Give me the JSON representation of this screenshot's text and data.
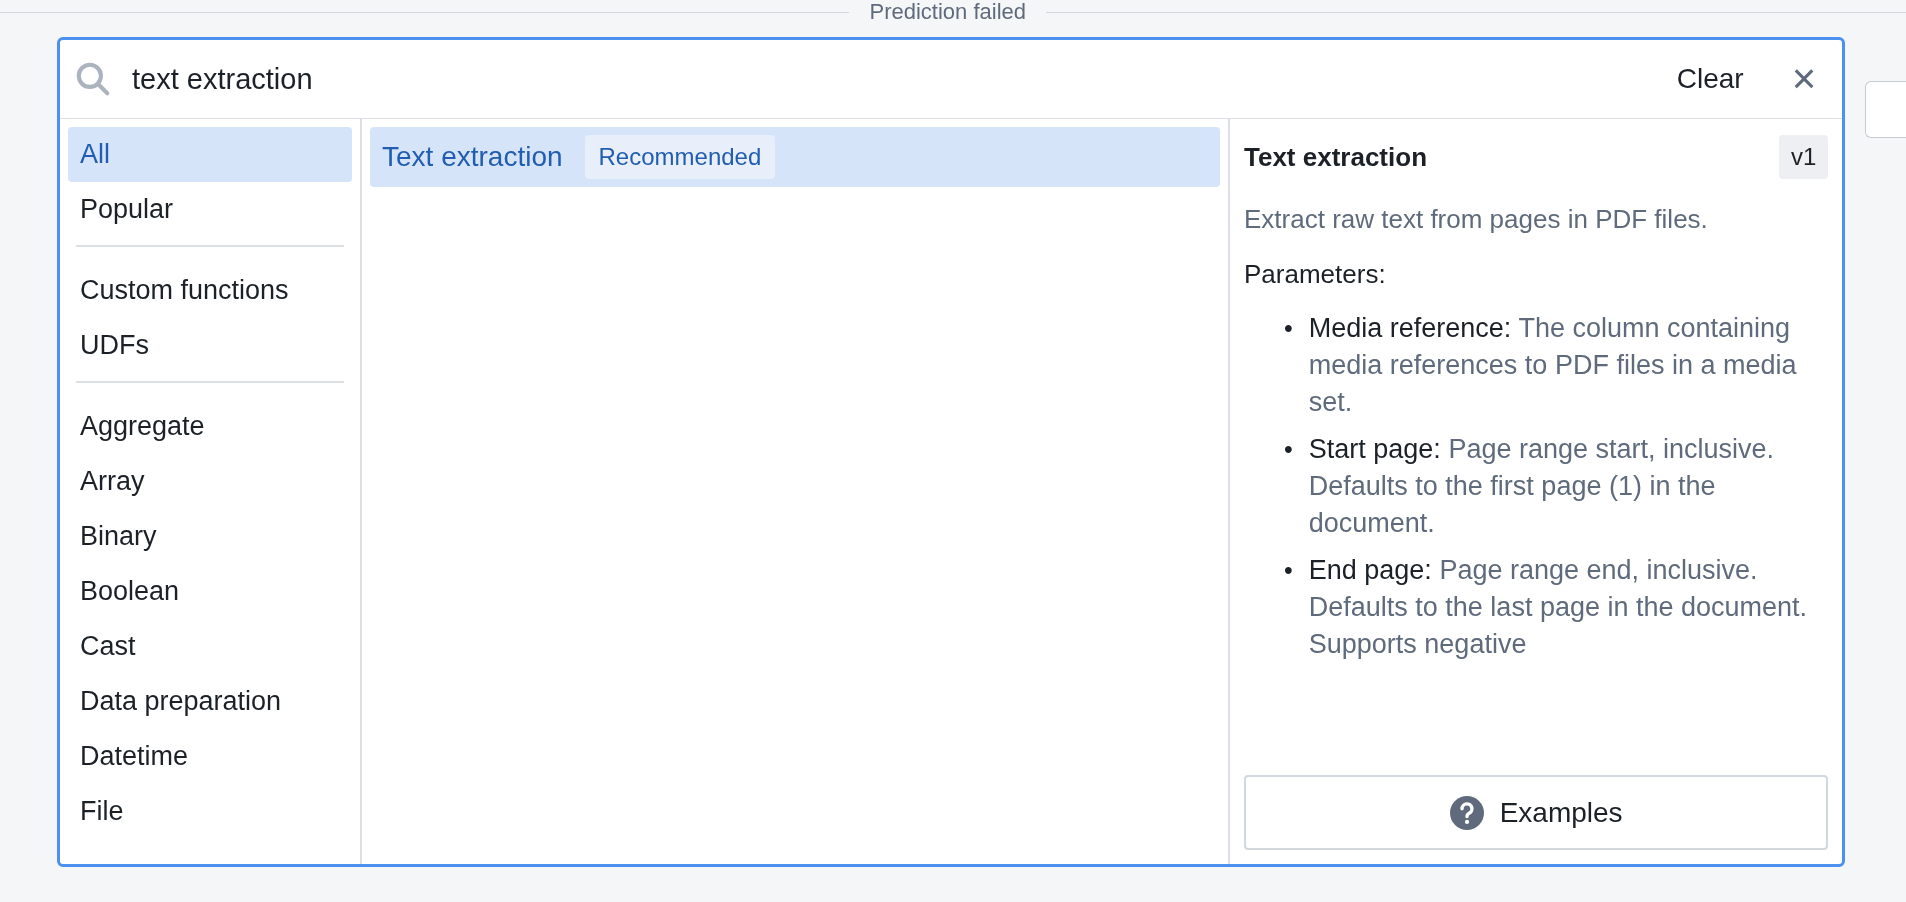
{
  "header": {
    "title": "Prediction failed"
  },
  "search": {
    "value": "text extraction",
    "clear_label": "Clear",
    "close_label": "×"
  },
  "categories": [
    {
      "items": [
        {
          "label": "All",
          "selected": true
        },
        {
          "label": "Popular",
          "selected": false
        }
      ]
    },
    {
      "items": [
        {
          "label": "Custom functions",
          "selected": false
        },
        {
          "label": "UDFs",
          "selected": false
        }
      ]
    },
    {
      "items": [
        {
          "label": "Aggregate",
          "selected": false
        },
        {
          "label": "Array",
          "selected": false
        },
        {
          "label": "Binary",
          "selected": false
        },
        {
          "label": "Boolean",
          "selected": false
        },
        {
          "label": "Cast",
          "selected": false
        },
        {
          "label": "Data preparation",
          "selected": false
        },
        {
          "label": "Datetime",
          "selected": false
        },
        {
          "label": "File",
          "selected": false
        }
      ]
    }
  ],
  "results": [
    {
      "label": "Text extraction",
      "badge": "Recommended",
      "selected": true
    }
  ],
  "detail": {
    "title": "Text extraction",
    "version": "v1",
    "description": "Extract raw text from pages in PDF files.",
    "parameters_label": "Parameters:",
    "parameters": [
      {
        "bullet": "•",
        "name": "Media reference:",
        "description": "The column containing media references to PDF files in a media set."
      },
      {
        "bullet": "•",
        "name": "Start page:",
        "description": "Page range start, inclusive. Defaults to the first page (1) in the document."
      },
      {
        "bullet": "•",
        "name": "End page:",
        "description": "Page range end, inclusive. Defaults to the last page in the document. Supports negative"
      }
    ],
    "examples_label": "Examples"
  }
}
